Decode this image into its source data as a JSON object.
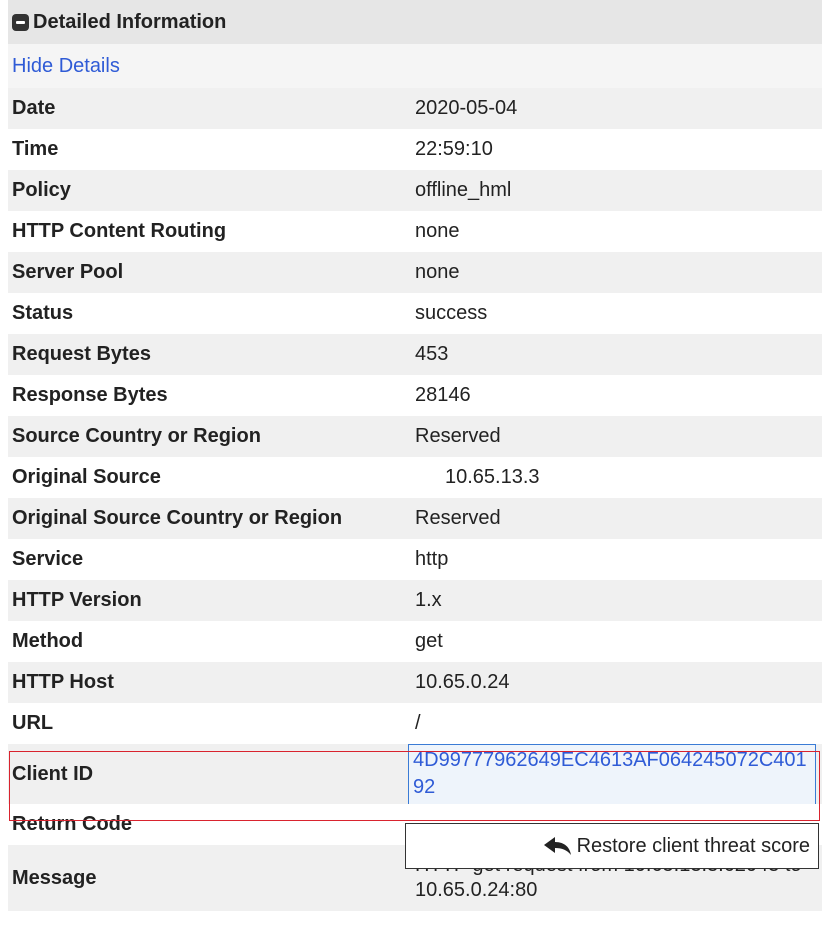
{
  "header": {
    "title": "Detailed Information",
    "toggle_icon": "minus-square-icon"
  },
  "hide_details_label": "Hide Details",
  "rows": [
    {
      "label": "Date",
      "value": "2020-05-04"
    },
    {
      "label": "Time",
      "value": "22:59:10"
    },
    {
      "label": "Policy",
      "value": "offline_hml"
    },
    {
      "label": "HTTP Content Routing",
      "value": "none"
    },
    {
      "label": "Server Pool",
      "value": "none"
    },
    {
      "label": "Status",
      "value": "success"
    },
    {
      "label": "Request Bytes",
      "value": "453"
    },
    {
      "label": "Response Bytes",
      "value": "28146"
    },
    {
      "label": "Source Country or Region",
      "value": "Reserved"
    },
    {
      "label": "Original Source",
      "value": "10.65.13.3"
    },
    {
      "label": "Original Source Country or Region",
      "value": "Reserved"
    },
    {
      "label": "Service",
      "value": "http"
    },
    {
      "label": "HTTP Version",
      "value": "1.x"
    },
    {
      "label": "Method",
      "value": "get"
    },
    {
      "label": "HTTP Host",
      "value": "10.65.0.24"
    },
    {
      "label": "URL",
      "value": "/"
    },
    {
      "label": "Client ID",
      "value": "4D99777962649EC4613AF064245072C40192"
    },
    {
      "label": "Return Code",
      "value": ""
    },
    {
      "label": "Message",
      "value": "HTTP get request from 10.65.13.3:62043 to 10.65.0.24:80"
    }
  ],
  "restore_button": {
    "label": "Restore client threat score",
    "icon": "reply-arrow-icon"
  },
  "colors": {
    "link": "#2f5bd6",
    "highlight_border": "#d9232e",
    "header_bg": "#e6e6e6",
    "alt_row_bg": "#f0f0f0"
  }
}
